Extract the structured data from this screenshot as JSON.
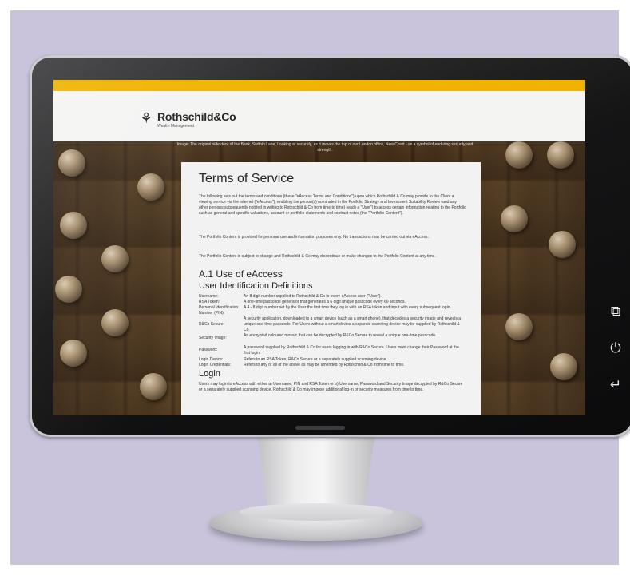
{
  "brand": {
    "name": "Rothschild&Co",
    "sub": "Wealth Management",
    "accent": "#f1b300"
  },
  "hero_caption": "Image: The original side door of the Bank, Swithin Lane, Looking at securely, as it moves the top of our London office, New Court - as a symbol of enduring security and strength.",
  "page": {
    "title": "Terms of Service",
    "intro": [
      "The following sets out the terms and conditions (these \"eAccess Terms and Conditions\") upon which Rothschild & Co may provide to the Client a viewing service via the internet (\"eAccess\"), enabling the person(s) nominated in the Portfolio Strategy and Investment Suitability Review (and any other persons subsequently notified in writing to Rothschild & Co from time to time) (each a \"User\") to access certain information relating to the Portfolio such as general and specific valuations, account or portfolio statements and contract notes (the \"Portfolio Content\").",
      "The Portfolio Content is provided for personal use and information purposes only. No transactions may be carried out via eAccess.",
      "The Portfolio Content is subject to change and Rothschild & Co may discontinue or make changes to the Portfolio Content at any time."
    ],
    "section_a1": "A.1 Use of eAccess",
    "section_defs": "User Identification Definitions",
    "definitions": [
      {
        "term": "Username:",
        "desc": "An 8 digit number supplied to Rothschild & Co to every eAccess user (\"User\")."
      },
      {
        "term": "RSA Token:",
        "desc": "A one-time passcode generator that generates a 6 digit unique passcode every 60 seconds."
      },
      {
        "term": "Personal Identification Number (PIN):",
        "desc": "A 4 - 8 digit number set by the User the first time they log in with an RSA token and input with every subsequent login."
      },
      {
        "term": "R&Co Secure:",
        "desc": "A security application, downloaded to a smart device (such as a smart phone), that decodes a security image and reveals a unique one-time passcode. For Users without a smart device a separate scanning device may be supplied by Rothschild & Co."
      },
      {
        "term": "Security Image:",
        "desc": "An encrypted coloured mosaic that can be decrypted by R&Co Secure to reveal a unique one-time passcode."
      },
      {
        "term": "Password:",
        "desc": "A password supplied by Rothschild & Co for users logging in with R&Co Secure. Users must change their Password at the first login."
      },
      {
        "term": "Login Device:",
        "desc": "Refers to an RSA Token, R&Co Secure or a separately supplied scanning device."
      },
      {
        "term": "Login Credentials:",
        "desc": "Refers to any or all of the above as may be amended by Rothschild & Co from time to time."
      }
    ],
    "section_login": "Login",
    "login_text": "Users may login to eAccess with either a) Username, PIN and RSA Token or b) Username, Password and Security Image decrypted by R&Co Secure or a separately supplied scanning device. Rothschild & Co may impose additional log-in or security measures from time to time."
  },
  "side_icons": [
    "windows-icon",
    "power-icon",
    "back-icon"
  ]
}
